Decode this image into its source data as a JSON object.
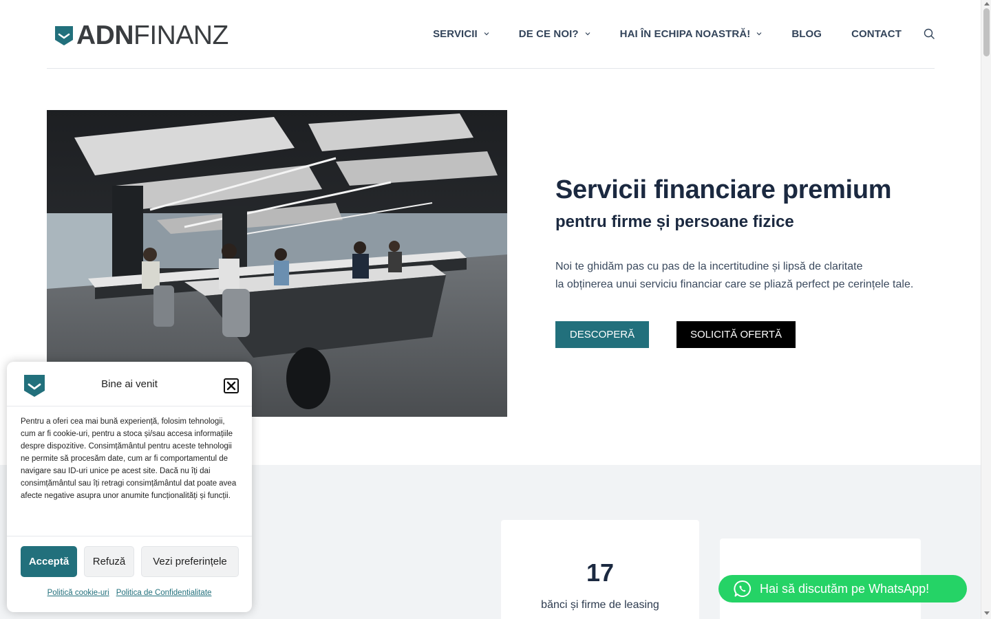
{
  "brand": {
    "logo_bold": "ADN",
    "logo_light": "FINANZ",
    "logo_icon": "shield-chevron-icon",
    "accent_color": "#22707c"
  },
  "nav": {
    "items": [
      {
        "label": "SERVICII",
        "has_dropdown": true
      },
      {
        "label": "DE CE NOI?",
        "has_dropdown": true
      },
      {
        "label": "HAI ÎN ECHIPA NOASTRĂ!",
        "has_dropdown": true
      },
      {
        "label": "BLOG",
        "has_dropdown": false
      },
      {
        "label": "CONTACT",
        "has_dropdown": false
      }
    ],
    "search_icon": "search-icon"
  },
  "hero": {
    "title": "Servicii financiare premium",
    "subtitle": "pentru firme și persoane fizice",
    "description_line1": "Noi te ghidăm pas cu pas de la incertitudine și lipsă de claritate",
    "description_line2": "la obținerea unui serviciu financiar care se pliază perfect pe cerințele tale.",
    "primary_button": "DESCOPERĂ",
    "secondary_button": "SOLICITĂ OFERTĂ"
  },
  "stats": {
    "card1_number": "17",
    "card1_label": "bănci și firme de leasing"
  },
  "cookie": {
    "title": "Bine ai venit",
    "body": "Pentru a oferi cea mai bună experiență, folosim tehnologii, cum ar fi cookie-uri, pentru a stoca și/sau accesa informațiile despre dispozitive. Consimțământul pentru aceste tehnologii ne permite să procesăm date, cum ar fi comportamentul de navigare sau ID-uri unice pe acest site. Dacă nu îți dai consimțământul sau îți retragi consimțământul dat poate avea afecte negative asupra unor anumite funcționalități și funcții.",
    "accept": "Acceptă",
    "refuse": "Refuză",
    "preferences": "Vezi preferințele",
    "link_cookie": "Politică cookie-uri",
    "link_privacy": "Politica de Confidențialitate"
  },
  "whatsapp": {
    "label": "Hai să discutăm pe WhatsApp!",
    "color": "#25d366"
  }
}
